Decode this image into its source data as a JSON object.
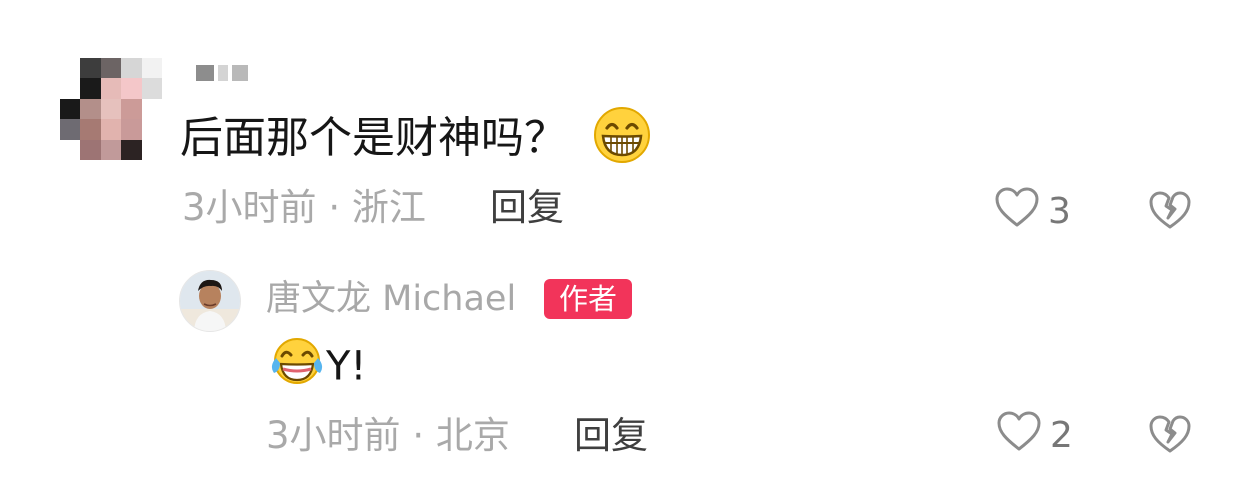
{
  "top_comment": {
    "text": "后面那个是财神吗？",
    "emoji": "grinning-face-emoji",
    "time": "3小时前",
    "separator": "·",
    "location": "浙江",
    "reply_label": "回复",
    "likes": "3"
  },
  "reply": {
    "author": "唐文龙 Michael",
    "badge": "作者",
    "emoji": "tears-of-joy-emoji",
    "text": "Y!",
    "time": "3小时前",
    "separator": "·",
    "location": "北京",
    "reply_label": "回复",
    "likes": "2"
  },
  "colors": {
    "badge": "#f2345a",
    "meta_text": "#a9a9a9",
    "icon": "#8a8a8a"
  }
}
